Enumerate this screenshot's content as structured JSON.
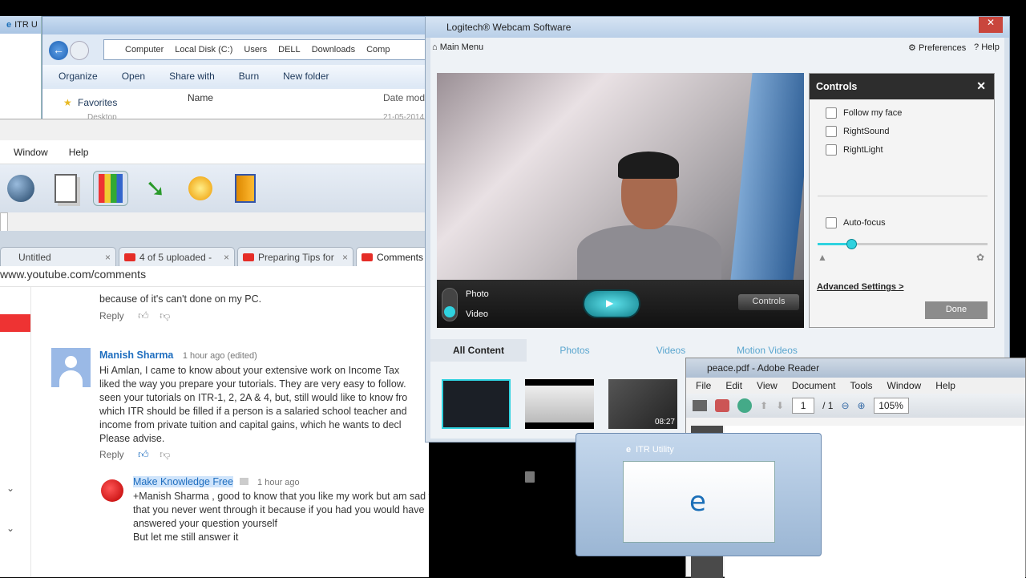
{
  "explorer": {
    "left_title": "ITR U",
    "breadcrumb": [
      "Computer",
      "Local Disk (C:)",
      "Users",
      "DELL",
      "Downloads",
      "Comp"
    ],
    "commands": [
      "Organize",
      "Open",
      "Share with",
      "Burn",
      "New folder"
    ],
    "favorites_label": "Favorites",
    "col_name": "Name",
    "col_date": "Date modi",
    "faded_row": "Desktop",
    "faded_date": "21-05-2014"
  },
  "app": {
    "menu": [
      "Window",
      "Help"
    ]
  },
  "browser": {
    "tabs": [
      {
        "label": "Untitled",
        "yt": false,
        "active": false
      },
      {
        "label": "4 of 5 uploaded -",
        "yt": true,
        "active": false
      },
      {
        "label": "Preparing Tips for",
        "yt": true,
        "active": false
      },
      {
        "label": "Comments -",
        "yt": true,
        "active": true
      }
    ],
    "url": "www.youtube.com/comments",
    "comments": {
      "c0_text": "because of it's can't done on my PC.",
      "reply_label": "Reply",
      "c1_name": "Manish Sharma",
      "c1_time": "1 hour ago (edited)",
      "c1_lines": [
        "Hi Amlan,  I came to know about your extensive work on Income Tax",
        "liked the way you prepare your tutorials. They are very easy to follow.",
        "seen your tutorials on ITR-1, 2, 2A & 4, but, still would like to know fro",
        "which ITR should be filled if a person is a salaried school teacher and",
        "income from private tuition and capital gains, which he wants to decl",
        "Please advise."
      ],
      "c2_name": "Make Knowledge Free",
      "c2_time": "1 hour ago",
      "c2_lines": [
        "+Manish Sharma , good to know that you like my work but am sad to see",
        "that you never went through it because if you had you would have",
        "answered your question yourself",
        "But let me still answer it"
      ]
    }
  },
  "logitech": {
    "title": "Logitech® Webcam Software",
    "main_menu": "Main Menu",
    "preferences": "Preferences",
    "help": "Help",
    "photo": "Photo",
    "video": "Video",
    "controls_btn": "Controls",
    "panel": {
      "title": "Controls",
      "follow": "Follow my face",
      "rightsound": "RightSound",
      "rightlight": "RightLight",
      "autofocus": "Auto-focus",
      "focus_level": 0.2,
      "advanced": "Advanced Settings >",
      "done": "Done"
    },
    "content_tabs": [
      "All Content",
      "Photos",
      "Videos",
      "Motion Videos"
    ],
    "thumb_duration": "08:27"
  },
  "reader": {
    "title": "peace.pdf - Adobe Reader",
    "menu": [
      "File",
      "Edit",
      "View",
      "Document",
      "Tools",
      "Window",
      "Help"
    ],
    "page": "1",
    "page_total": "/ 1",
    "zoom": "105%"
  },
  "itr": {
    "title": "ITR Utility"
  },
  "colors": {
    "accent": "#1f6ebf",
    "logi_teal": "#2fd2df",
    "yt_red": "#e52d27"
  }
}
